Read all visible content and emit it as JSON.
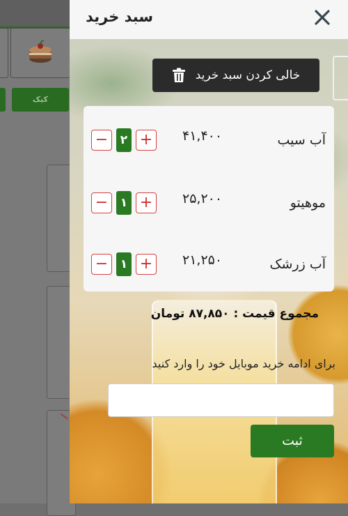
{
  "background_page": {
    "category_chip": "کیک"
  },
  "cart": {
    "title": "سبد خرید",
    "clear_label": "خالی کردن سبد خرید",
    "items": [
      {
        "name": "آب سیب",
        "price": "۴۱,۴۰۰",
        "qty": "۲"
      },
      {
        "name": "موهیتو",
        "price": "۲۵,۲۰۰",
        "qty": "۱"
      },
      {
        "name": "آب زرشک",
        "price": "۲۱,۲۵۰",
        "qty": "۱"
      }
    ],
    "plus": "+",
    "minus": "−",
    "total_label": "مجموع قیمت : ۸۷,۸۵۰ تومان",
    "phone_prompt": "برای ادامه خرید موبایل خود را وارد کنید",
    "phone_value": "",
    "submit_label": "ثبت"
  },
  "colors": {
    "accent_green": "#2a7a24",
    "danger_red": "#d12e2e",
    "dark_button": "#2b2b2b"
  },
  "icons": {
    "close": "close-icon",
    "trash": "trash-icon",
    "cake": "cake-icon"
  }
}
